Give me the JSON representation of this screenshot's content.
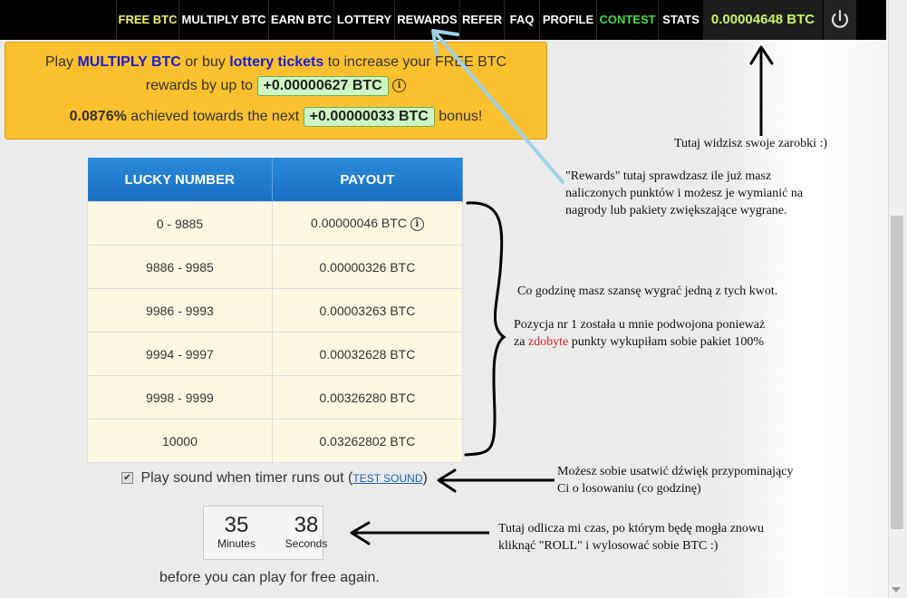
{
  "nav": {
    "items": [
      {
        "label": "FREE BTC",
        "color": "#f0f25c"
      },
      {
        "label": "MULTIPLY BTC",
        "color": "#ffffff"
      },
      {
        "label": "EARN BTC",
        "color": "#ffffff"
      },
      {
        "label": "LOTTERY",
        "color": "#ffffff"
      },
      {
        "label": "REWARDS",
        "color": "#ffffff"
      },
      {
        "label": "REFER",
        "color": "#ffffff"
      },
      {
        "label": "FAQ",
        "color": "#ffffff"
      },
      {
        "label": "PROFILE",
        "color": "#ffffff"
      },
      {
        "label": "CONTEST",
        "color": "#3fdc3f"
      },
      {
        "label": "STATS",
        "color": "#ffffff"
      }
    ],
    "balance": "0.00004648 BTC",
    "power_icon": "power-icon"
  },
  "promo": {
    "play": "Play",
    "multiply_link": "MULTIPLY BTC",
    "or_buy": "or buy",
    "lottery_link": "lottery tickets",
    "increase_text": "to increase your FREE BTC",
    "rewards_by": "rewards by up to",
    "bonus_amount": "+0.00000627 BTC",
    "percent": "0.0876%",
    "achieved_text": "achieved towards the next",
    "next_bonus": "+0.00000033 BTC",
    "bonus_word": "bonus!"
  },
  "table": {
    "headers": [
      "LUCKY NUMBER",
      "PAYOUT"
    ],
    "rows": [
      {
        "range": "0 - 9885",
        "payout": "0.00000046 BTC"
      },
      {
        "range": "9886 - 9985",
        "payout": "0.00000326 BTC"
      },
      {
        "range": "9986 - 9993",
        "payout": "0.00003263 BTC"
      },
      {
        "range": "9994 - 9997",
        "payout": "0.00032628 BTC"
      },
      {
        "range": "9998 - 9999",
        "payout": "0.00326280 BTC"
      },
      {
        "range": "10000",
        "payout": "0.03262802 BTC"
      }
    ]
  },
  "sound": {
    "label": "Play sound when timer runs out",
    "test_link": "TEST SOUND",
    "checked_glyph": "✔"
  },
  "timer": {
    "minutes": "35",
    "minutes_label": "Minutes",
    "seconds": "38",
    "seconds_label": "Seconds",
    "after_text": "before you can play for free again."
  },
  "notes": {
    "earnings": "Tutaj widzisz swoje zarobki :)",
    "rewards_1": "\"Rewards\" tutaj sprawdzasz ile już masz",
    "rewards_2": "naliczonych punktów i możesz je wymianić na",
    "rewards_3": "nagrody lub pakiety zwiększające wygrane.",
    "hourly": "Co godzinę masz szansę wygrać jedną z tych kwot.",
    "doubled_1": "Pozycja nr 1 została u mnie podwojona ponieważ",
    "doubled_2a": "za",
    "doubled_2_red": "zdobyte",
    "doubled_2b": "punkty wykupiłam sobie pakiet 100%",
    "sound_1": "Możesz sobie usatwić dźwięk przypominający",
    "sound_2": "Ci o losowaniu (co godzinę)",
    "timer_1": "Tutaj odlicza mi czas, po którym będę mogła znowu",
    "timer_2": "kliknąć \"ROLL\" i wylosować sobie BTC :)"
  },
  "colors": {
    "annotation_arrow": "#9fd3e8",
    "balance": "#c7f36b",
    "promo_bg": "#fbc02d",
    "table_header": "#1a6fc4"
  }
}
